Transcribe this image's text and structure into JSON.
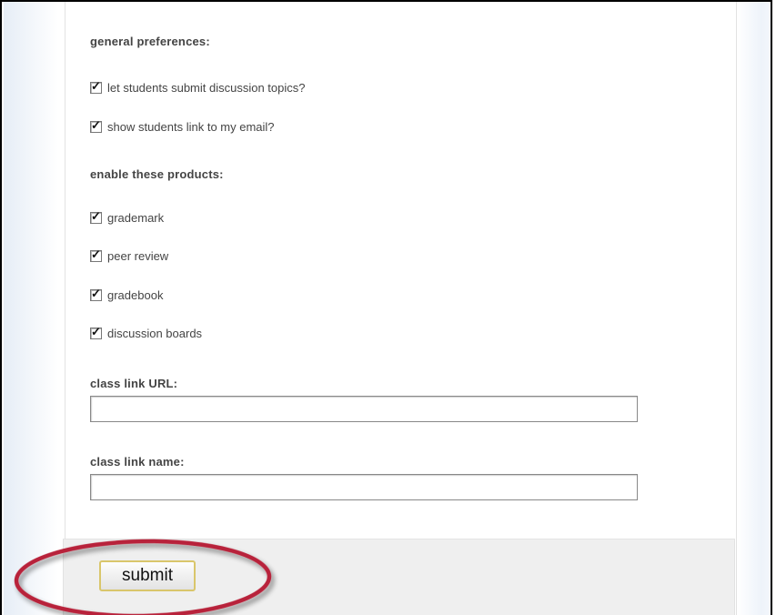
{
  "preferences": {
    "general_heading": "general preferences:",
    "options": [
      {
        "label": "let students submit discussion topics?",
        "checked": true
      },
      {
        "label": "show students link to my email?",
        "checked": true
      }
    ]
  },
  "products": {
    "heading": "enable these products:",
    "items": [
      {
        "label": "grademark",
        "checked": true
      },
      {
        "label": "peer review",
        "checked": true
      },
      {
        "label": "gradebook",
        "checked": true
      },
      {
        "label": "discussion boards",
        "checked": true
      }
    ]
  },
  "class_link_url": {
    "label": "class link URL:",
    "value": ""
  },
  "class_link_name": {
    "label": "class link name:",
    "value": ""
  },
  "footer": {
    "submit_label": "submit"
  },
  "check_glyph": "✓",
  "colors": {
    "highlight_ring": "#b8243a",
    "button_border": "#d9c66b",
    "footer_bg": "#efefef",
    "text": "#444444"
  }
}
